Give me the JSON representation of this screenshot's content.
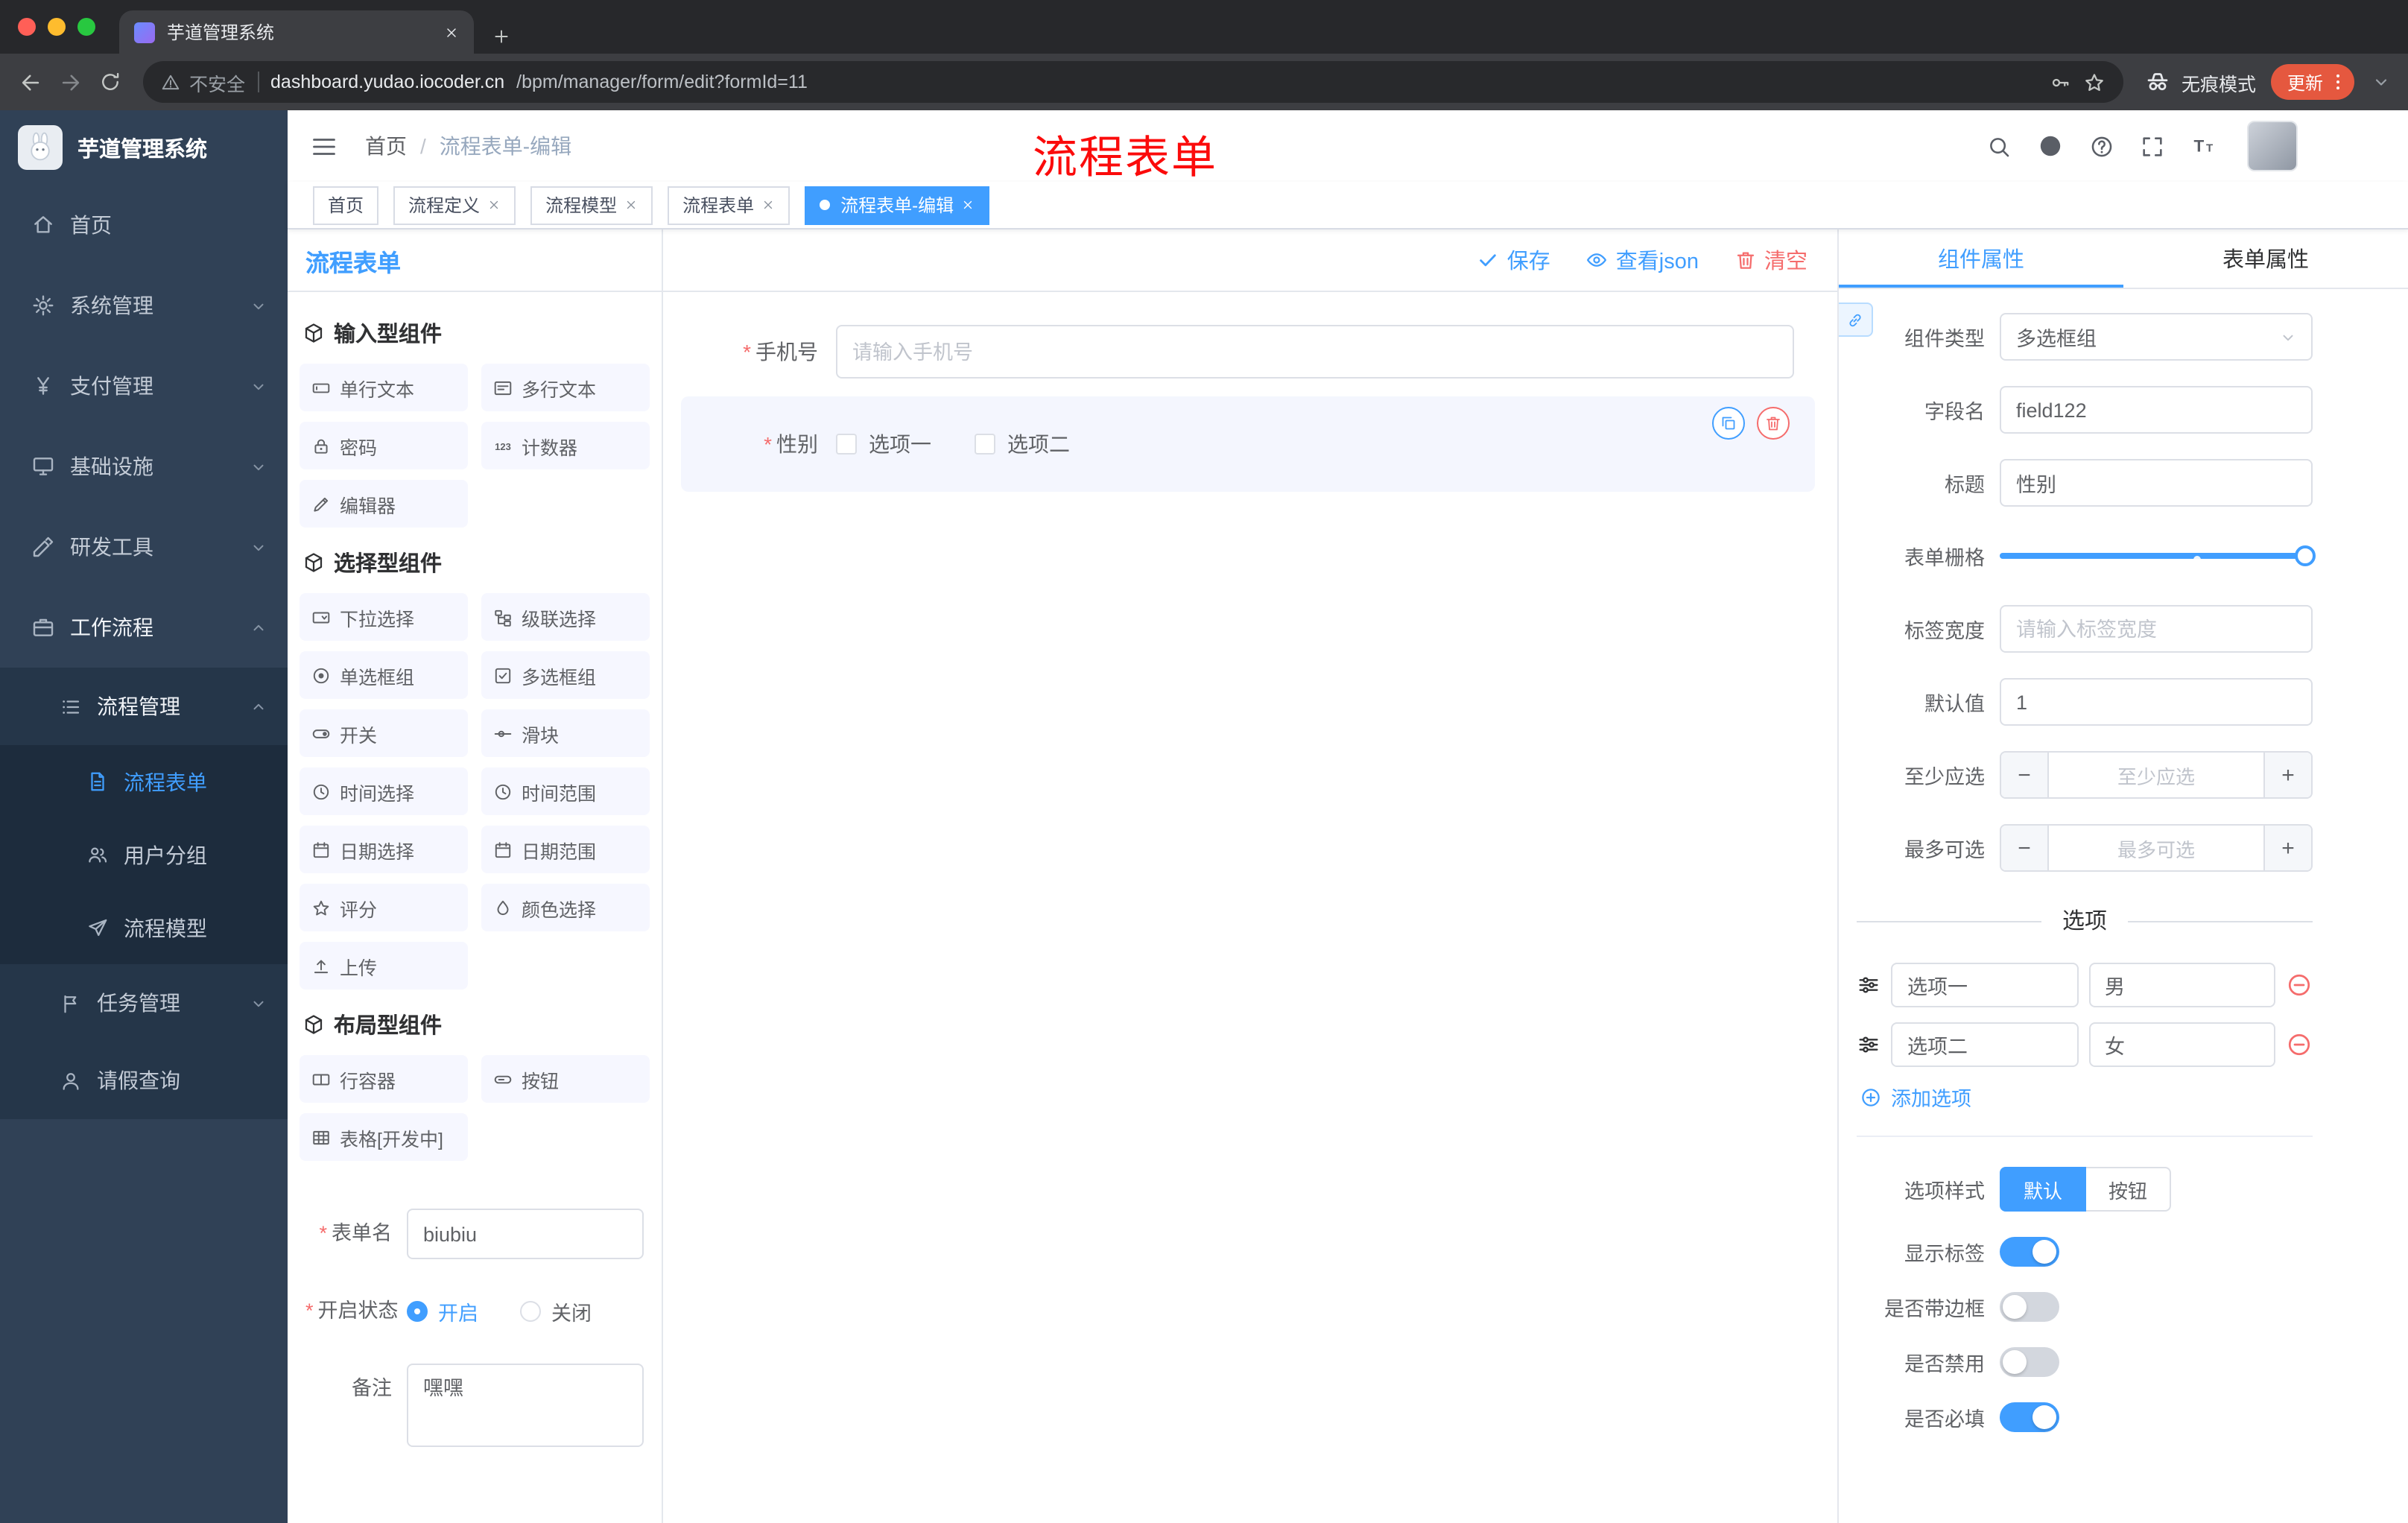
{
  "colors": {
    "primary": "#409eff",
    "danger": "#f56c6c",
    "annotation_red": "#fb0b0b",
    "sidebar_bg": "#304156",
    "active_tag_bg": "#409eff",
    "update_pill_bg": "#e5583f"
  },
  "browser": {
    "tab_title": "芋道管理系统",
    "security_label": "不安全",
    "url_host": "dashboard.yudao.iocoder.cn",
    "url_path": "/bpm/manager/form/edit?formId=11",
    "incognito_label": "无痕模式",
    "update_label": "更新"
  },
  "sidebar": {
    "brand": "芋道管理系统",
    "items": [
      {
        "label": "首页"
      },
      {
        "label": "系统管理"
      },
      {
        "label": "支付管理"
      },
      {
        "label": "基础设施"
      },
      {
        "label": "研发工具"
      },
      {
        "label": "工作流程"
      },
      {
        "label": "流程管理"
      },
      {
        "label": "流程表单"
      },
      {
        "label": "用户分组"
      },
      {
        "label": "流程模型"
      },
      {
        "label": "任务管理"
      },
      {
        "label": "请假查询"
      }
    ]
  },
  "header": {
    "breadcrumb": {
      "root": "首页",
      "separator": "/",
      "current": "流程表单-编辑"
    },
    "annotation": "流程表单"
  },
  "tags": [
    {
      "label": "首页",
      "closable": false,
      "active": false
    },
    {
      "label": "流程定义",
      "closable": true,
      "active": false
    },
    {
      "label": "流程模型",
      "closable": true,
      "active": false
    },
    {
      "label": "流程表单",
      "closable": true,
      "active": false
    },
    {
      "label": "流程表单-编辑",
      "closable": true,
      "active": true
    }
  ],
  "designer": {
    "panel_title": "流程表单",
    "actions": {
      "save": "保存",
      "view_json": "查看json",
      "clear": "清空"
    },
    "groups": {
      "input": {
        "title": "输入型组件",
        "items": [
          "单行文本",
          "多行文本",
          "密码",
          "计数器",
          "编辑器"
        ]
      },
      "select": {
        "title": "选择型组件",
        "items": [
          "下拉选择",
          "级联选择",
          "单选框组",
          "多选框组",
          "开关",
          "滑块",
          "时间选择",
          "时间范围",
          "日期选择",
          "日期范围",
          "评分",
          "颜色选择",
          "上传"
        ]
      },
      "layout": {
        "title": "布局型组件",
        "items": [
          "行容器",
          "按钮",
          "表格[开发中]"
        ]
      }
    },
    "meta": {
      "name_label": "表单名",
      "name_value": "biubiu",
      "status_label": "开启状态",
      "status_on": "开启",
      "status_off": "关闭",
      "remark_label": "备注",
      "remark_value": "嘿嘿"
    }
  },
  "canvas": {
    "phone": {
      "label": "手机号",
      "placeholder": "请输入手机号"
    },
    "gender": {
      "label": "性别",
      "options": [
        "选项一",
        "选项二"
      ]
    }
  },
  "props": {
    "tabs": {
      "component": "组件属性",
      "form": "表单属性"
    },
    "component_type": {
      "label": "组件类型",
      "value": "多选框组"
    },
    "field_name": {
      "label": "字段名",
      "value": "field122"
    },
    "title": {
      "label": "标题",
      "value": "性别"
    },
    "grid": {
      "label": "表单栅格"
    },
    "label_width": {
      "label": "标签宽度",
      "placeholder": "请输入标签宽度"
    },
    "default_value": {
      "label": "默认值",
      "value": "1"
    },
    "min_select": {
      "label": "至少应选",
      "placeholder": "至少应选"
    },
    "max_select": {
      "label": "最多可选",
      "placeholder": "最多可选"
    },
    "options": {
      "divider": "选项",
      "rows": [
        {
          "label": "选项一",
          "value": "男"
        },
        {
          "label": "选项二",
          "value": "女"
        }
      ],
      "add": "添加选项"
    },
    "option_style": {
      "label": "选项样式",
      "default": "默认",
      "button": "按钮"
    },
    "show_label": {
      "label": "显示标签",
      "on": true
    },
    "border": {
      "label": "是否带边框",
      "on": false
    },
    "disabled": {
      "label": "是否禁用",
      "on": false
    },
    "required": {
      "label": "是否必填",
      "on": true
    }
  },
  "ui": {
    "required_marker": "*",
    "minus": "−",
    "plus": "+"
  }
}
